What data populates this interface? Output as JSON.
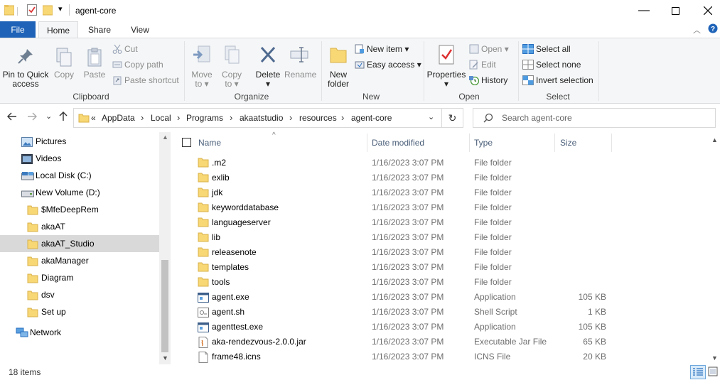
{
  "window": {
    "title": "agent-core"
  },
  "ribbon": {
    "tabs": [
      "File",
      "Home",
      "Share",
      "View"
    ],
    "active_tab": "Home",
    "clipboard": {
      "label": "Clipboard",
      "pin_line1": "Pin to Quick",
      "pin_line2": "access",
      "copy": "Copy",
      "paste": "Paste",
      "cut": "Cut",
      "copy_path": "Copy path",
      "paste_shortcut": "Paste shortcut"
    },
    "organize": {
      "label": "Organize",
      "move_line1": "Move",
      "move_line2": "to",
      "copy_line1": "Copy",
      "copy_line2": "to",
      "delete": "Delete",
      "rename": "Rename"
    },
    "new": {
      "label": "New",
      "new_folder_line1": "New",
      "new_folder_line2": "folder",
      "new_item": "New item",
      "easy_access": "Easy access"
    },
    "open": {
      "label": "Open",
      "properties": "Properties",
      "open": "Open",
      "edit": "Edit",
      "history": "History"
    },
    "select": {
      "label": "Select",
      "select_all": "Select all",
      "select_none": "Select none",
      "invert_selection": "Invert selection"
    }
  },
  "address": {
    "overflow": "«",
    "crumbs": [
      "AppData",
      "Local",
      "Programs",
      "akaatstudio",
      "resources",
      "agent-core"
    ],
    "search_placeholder": "Search agent-core"
  },
  "nav_pane": {
    "items": [
      {
        "label": "Pictures",
        "icon": "pictures-icon",
        "indent": 1
      },
      {
        "label": "Videos",
        "icon": "videos-icon",
        "indent": 1
      },
      {
        "label": "Local Disk (C:)",
        "icon": "disk-icon",
        "indent": 1
      },
      {
        "label": "New Volume (D:)",
        "icon": "drive-icon",
        "indent": 1
      },
      {
        "label": "$MfeDeepRem",
        "icon": "folder-icon",
        "indent": 2
      },
      {
        "label": "akaAT",
        "icon": "folder-icon",
        "indent": 2
      },
      {
        "label": "akaAT_Studio",
        "icon": "folder-icon",
        "indent": 2,
        "selected": true
      },
      {
        "label": "akaManager",
        "icon": "folder-icon",
        "indent": 2
      },
      {
        "label": "Diagram",
        "icon": "folder-icon",
        "indent": 2
      },
      {
        "label": "dsv",
        "icon": "folder-icon",
        "indent": 2
      },
      {
        "label": "Set up",
        "icon": "folder-icon",
        "indent": 2
      },
      {
        "label": "Network",
        "icon": "network-icon",
        "indent": 0
      }
    ]
  },
  "file_list": {
    "columns": {
      "name": "Name",
      "date": "Date modified",
      "type": "Type",
      "size": "Size"
    },
    "rows": [
      {
        "name": ".m2",
        "date": "1/16/2023 3:07 PM",
        "type": "File folder",
        "size": "",
        "icon": "folder-icon"
      },
      {
        "name": "exlib",
        "date": "1/16/2023 3:07 PM",
        "type": "File folder",
        "size": "",
        "icon": "folder-icon"
      },
      {
        "name": "jdk",
        "date": "1/16/2023 3:07 PM",
        "type": "File folder",
        "size": "",
        "icon": "folder-icon"
      },
      {
        "name": "keyworddatabase",
        "date": "1/16/2023 3:07 PM",
        "type": "File folder",
        "size": "",
        "icon": "folder-icon"
      },
      {
        "name": "languageserver",
        "date": "1/16/2023 3:07 PM",
        "type": "File folder",
        "size": "",
        "icon": "folder-icon"
      },
      {
        "name": "lib",
        "date": "1/16/2023 3:07 PM",
        "type": "File folder",
        "size": "",
        "icon": "folder-icon"
      },
      {
        "name": "releasenote",
        "date": "1/16/2023 3:07 PM",
        "type": "File folder",
        "size": "",
        "icon": "folder-icon"
      },
      {
        "name": "templates",
        "date": "1/16/2023 3:07 PM",
        "type": "File folder",
        "size": "",
        "icon": "folder-icon"
      },
      {
        "name": "tools",
        "date": "1/16/2023 3:07 PM",
        "type": "File folder",
        "size": "",
        "icon": "folder-icon"
      },
      {
        "name": "agent.exe",
        "date": "1/16/2023 3:07 PM",
        "type": "Application",
        "size": "105 KB",
        "icon": "exe-icon"
      },
      {
        "name": "agent.sh",
        "date": "1/16/2023 3:07 PM",
        "type": "Shell Script",
        "size": "1 KB",
        "icon": "script-icon"
      },
      {
        "name": "agenttest.exe",
        "date": "1/16/2023 3:07 PM",
        "type": "Application",
        "size": "105 KB",
        "icon": "exe-icon"
      },
      {
        "name": "aka-rendezvous-2.0.0.jar",
        "date": "1/16/2023 3:07 PM",
        "type": "Executable Jar File",
        "size": "65 KB",
        "icon": "jar-icon"
      },
      {
        "name": "frame48.icns",
        "date": "1/16/2023 3:07 PM",
        "type": "ICNS File",
        "size": "20 KB",
        "icon": "file-icon"
      }
    ]
  },
  "status": {
    "item_count": "18 items"
  },
  "colors": {
    "file_tab": "#1e63b8",
    "folder_yellow": "#f8d775",
    "selected_nav": "#d9d9d9",
    "header_text": "#4c607a"
  }
}
